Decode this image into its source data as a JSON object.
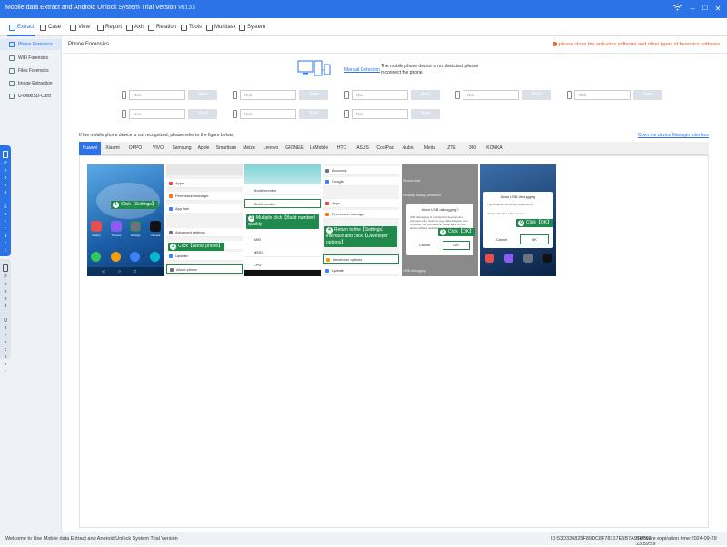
{
  "window": {
    "title": "Mobile data Extract and Android Unlock System Trial Version",
    "version": "V6.1.3.5",
    "controls": {
      "wifi": "wifi-icon",
      "minimize": "–",
      "maximize": "☐",
      "close": "✕"
    }
  },
  "toolbar": {
    "items": [
      {
        "label": "Extract",
        "icon": "extract-icon"
      },
      {
        "label": "Case",
        "icon": "case-icon"
      },
      {
        "label": "View",
        "icon": "view-icon"
      },
      {
        "label": "Report",
        "icon": "report-icon"
      },
      {
        "label": "Axis",
        "icon": "axis-icon"
      },
      {
        "label": "Relation",
        "icon": "relation-icon"
      },
      {
        "label": "Tools",
        "icon": "tools-icon"
      },
      {
        "label": "Multitask",
        "icon": "multitask-icon"
      },
      {
        "label": "System",
        "icon": "system-icon"
      }
    ]
  },
  "sidebar": {
    "items": [
      {
        "label": "Phone Forensics"
      },
      {
        "label": "WiFi Forensics"
      },
      {
        "label": "Files Forensics"
      },
      {
        "label": "Image Extraction"
      },
      {
        "label": "U-Disk/SD-Card"
      }
    ],
    "vtabs": [
      "Phone Extractor",
      "Phone Unlocker"
    ]
  },
  "main": {
    "title": "Phone Forensics",
    "warning": "please close the anti-virus software and other types of forensics software",
    "manual_detection": "Manual Detection",
    "not_detected": "The mobile phone device is not detected, please reconnect the phone.",
    "ports": [
      {
        "placeholder": "No1",
        "button": "Start"
      },
      {
        "placeholder": "No2",
        "button": "Start"
      },
      {
        "placeholder": "No3",
        "button": "Start"
      },
      {
        "placeholder": "No4",
        "button": "Start"
      },
      {
        "placeholder": "No5",
        "button": "Start"
      },
      {
        "placeholder": "No1",
        "button": "Start"
      },
      {
        "placeholder": "No1",
        "button": "Start"
      },
      {
        "placeholder": "No2",
        "button": "Start"
      }
    ],
    "hint": "If the mobile phone device is not recognized, please refer to the figure below.",
    "open_device_manager": "Open the device Manager interface",
    "brands": [
      "Huawei",
      "Xiaomi",
      "OPPO",
      "VIVO",
      "Samsung",
      "Apple",
      "Smartisan",
      "Meizu",
      "Lenovo",
      "GIONEE",
      "LeMobile",
      "HTC",
      "ASUS",
      "CoolPad",
      "Nubia",
      "Meitu",
      "ZTE",
      "360",
      "KONKA"
    ],
    "active_brand": "Huawei"
  },
  "guide": {
    "step1": "Click【Settings】",
    "step2": "Click【About phone】",
    "step3": "Multiple click【Build number】quickly",
    "step4": "Return to the【Settings】interface and click【Developer options】",
    "step5": "Click【OK】",
    "step6": "Click【OK】",
    "nums": [
      "1",
      "2",
      "3",
      "4",
      "5",
      "6"
    ],
    "home_icons": [
      "Gallery",
      "Themes",
      "Settings",
      "Camera"
    ],
    "menu1": [
      "Apps",
      "Permission manager",
      "App twin",
      "Advanced settings",
      "Developer options",
      "Updater",
      "About phone"
    ],
    "about": [
      "Model number",
      "Build number",
      "IMEI",
      "MEID",
      "CPU"
    ],
    "menu2": [
      "Accounts",
      "Google",
      "Apps",
      "Permission manager",
      "Developer options",
      "Updater"
    ],
    "dialog_title": "Allow USB debugging?",
    "dialog_text": "USB debugging is intended for development purposes only. Use it to copy data between your computer and your device, install apps on your device without notification, and read log data.",
    "cancel": "Cancel",
    "ok": "OK",
    "dialog2_title": "Allow USB debugging",
    "dialog2_text": "The computer's RSA key fingerprint is:",
    "always_allow": "Always allow from this computer",
    "screen_lock": "Screen lock",
    "desktop_backup": "Desktop backup password",
    "usb_debugging": "USB debugging"
  },
  "status": {
    "welcome": "Welcome to Use Mobile data Extract and Android Unlock System Trial Version",
    "id": "ID:53D336825F89DC8F78317E5B7A97E762",
    "expiration": "Software expiration time:2024-09-29 23:59:59"
  },
  "colors": {
    "brand": "#2b73e6",
    "warning": "#e05a2a",
    "step": "#1f8a4c"
  }
}
